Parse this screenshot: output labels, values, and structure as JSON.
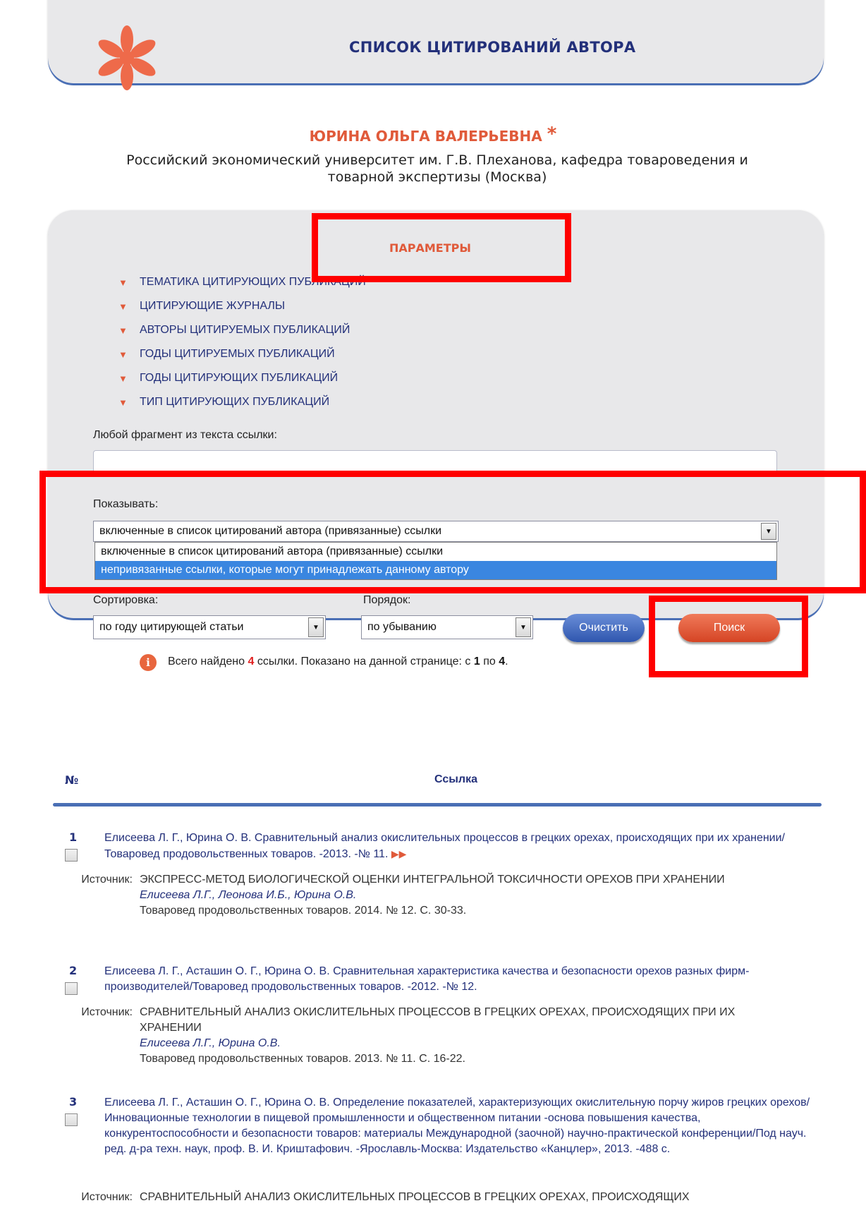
{
  "header": {
    "title": "СПИСОК ЦИТИРОВАНИЙ АВТОРА"
  },
  "author": {
    "name": "ЮРИНА ОЛЬГА ВАЛЕРЬЕВНА",
    "star": "*",
    "affiliation": "Российский экономический университет им. Г.В. Плеханова, кафедра товароведения и товарной экспертизы (Москва)"
  },
  "params": {
    "title": "ПАРАМЕТРЫ",
    "filters": [
      "ТЕМАТИКА ЦИТИРУЮЩИХ ПУБЛИКАЦИЙ",
      "ЦИТИРУЮЩИЕ ЖУРНАЛЫ",
      "АВТОРЫ ЦИТИРУЕМЫХ ПУБЛИКАЦИЙ",
      "ГОДЫ ЦИТИРУЕМЫХ ПУБЛИКАЦИЙ",
      "ГОДЫ ЦИТИРУЮЩИХ ПУБЛИКАЦИЙ",
      "ТИП ЦИТИРУЮЩИХ ПУБЛИКАЦИЙ"
    ],
    "fragment_label": "Любой фрагмент из текста ссылки:",
    "fragment_value": "",
    "show_label": "Показывать:",
    "show_selected": "включенные в список цитирований автора (привязанные) ссылки",
    "show_options": [
      "включенные в список цитирований автора (привязанные) ссылки",
      "непривязанные ссылки, которые могут принадлежать данному автору"
    ],
    "sort_label": "Сортировка:",
    "sort_value": "по году цитирующей статьи",
    "order_label": "Порядок:",
    "order_value": "по убыванию",
    "clear_button": "Очистить",
    "search_button": "Поиск"
  },
  "results": {
    "info_prefix": "Всего найдено ",
    "total": "4",
    "info_mid": " ссылки. Показано на данной странице: с ",
    "from": "1",
    "info_to": " по ",
    "to": "4",
    "info_end": ".",
    "col_no": "№",
    "col_ref": "Ссылка",
    "source_label": "Источник:",
    "items": [
      {
        "num": "1",
        "text": "Елисеева Л. Г., Юрина О. В. Сравнительный анализ окислительных процессов в грецких орехах, происходящих при их хранении/Товаровед продовольственных товаров. -2013. -№ 11.",
        "source_title": "ЭКСПРЕСС-МЕТОД БИОЛОГИЧЕСКОЙ ОЦЕНКИ ИНТЕГРАЛЬНОЙ ТОКСИЧНОСТИ ОРЕХОВ ПРИ ХРАНЕНИИ",
        "source_authors": "Елисеева Л.Г., Леонова И.Б., Юрина О.В.",
        "source_journal": "Товаровед продовольственных товаров. 2014. № 12. С. 30-33."
      },
      {
        "num": "2",
        "text": "Елисеева Л. Г., Асташин О. Г., Юрина О. В. Сравнительная характеристика качества и безопасности орехов разных фирм-производителей/Товаровед продовольственных товаров. -2012. -№ 12.",
        "source_title": "СРАВНИТЕЛЬНЫЙ АНАЛИЗ ОКИСЛИТЕЛЬНЫХ ПРОЦЕССОВ В ГРЕЦКИХ ОРЕХАХ, ПРОИСХОДЯЩИХ ПРИ ИХ ХРАНЕНИИ",
        "source_authors": "Елисеева Л.Г., Юрина О.В.",
        "source_journal": "Товаровед продовольственных товаров. 2013. № 11. С. 16-22."
      },
      {
        "num": "3",
        "text": "Елисеева Л. Г., Асташин О. Г., Юрина О. В. Определение показателей, характеризующих окислительную порчу жиров грецких орехов/Инновационные технологии в пищевой промышленности и общественном питании -основа повышения качества, конкурентоспособности и безопасности товаров: материалы Международной (заочной) научно-практической конференции/Под науч. ред. д-ра техн. наук, проф. В. И. Криштафович. -Ярославль-Москва: Издательство «Канцлер», 2013. -488 с.",
        "source_title": "СРАВНИТЕЛЬНЫЙ АНАЛИЗ ОКИСЛИТЕЛЬНЫХ ПРОЦЕССОВ В ГРЕЦКИХ ОРЕХАХ, ПРОИСХОДЯЩИХ"
      }
    ]
  },
  "colors": {
    "accent": "#e05a3a",
    "navy": "#23307a",
    "highlight": "#ff0000",
    "blue_button": "#2f56ae"
  }
}
